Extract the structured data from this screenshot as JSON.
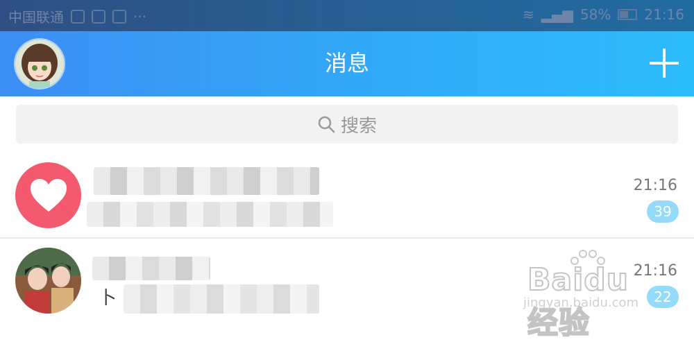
{
  "status_bar": {
    "carrier": "中国联通",
    "battery": "58%",
    "time": "21:16"
  },
  "header": {
    "title": "消息",
    "add_icon": "plus-icon",
    "avatar": "user-avatar"
  },
  "search": {
    "placeholder": "搜索",
    "icon": "search-icon"
  },
  "conversations": [
    {
      "time": "21:16",
      "unread": "39",
      "avatar": "heart-icon"
    },
    {
      "time": "21:16",
      "unread": "22",
      "preview_char": "卜",
      "avatar": "group-avatar"
    }
  ],
  "watermark": {
    "brand": "Baidu经验",
    "url": "jingyan.baidu.com"
  },
  "colors": {
    "header_start": "#3d8ef3",
    "header_end": "#2cbcfb",
    "badge": "#93dbf8",
    "heart_bg": "#f35a6f"
  }
}
